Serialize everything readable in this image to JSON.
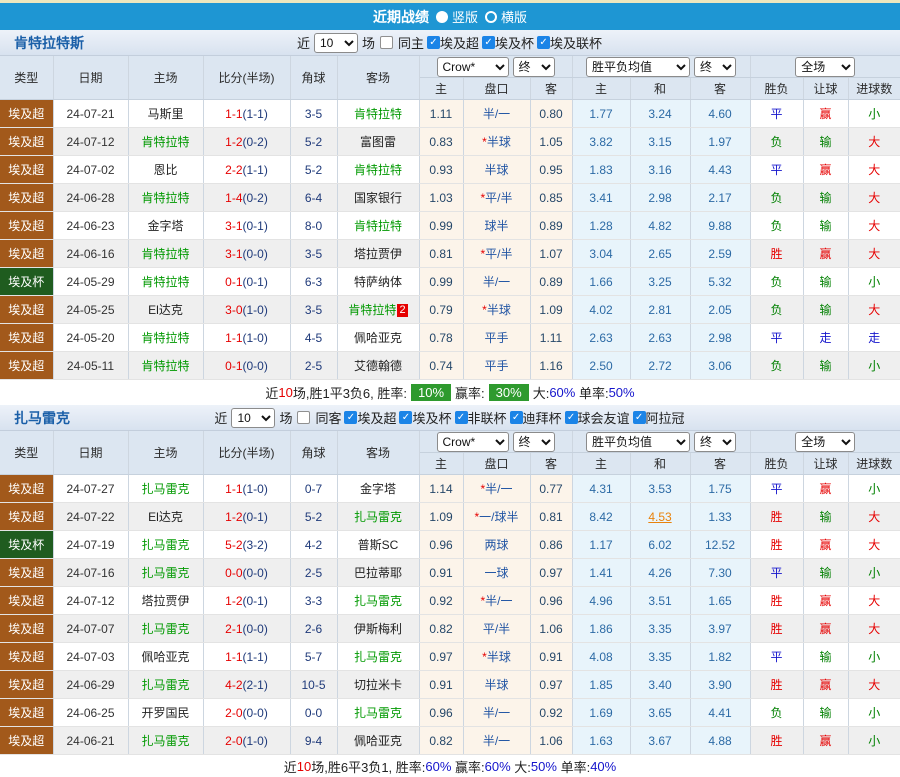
{
  "title_bar": {
    "title": "近期战绩",
    "vertical": "竖版",
    "horizontal": "横版"
  },
  "columns": {
    "type": "类型",
    "date": "日期",
    "home": "主场",
    "score": "比分(半场)",
    "corners": "角球",
    "away": "客场",
    "asia_home": "主",
    "asia_handicap": "盘口",
    "asia_away": "客",
    "euro_home": "主",
    "euro_draw": "和",
    "euro_away": "客",
    "res_wdl": "胜负",
    "res_handicap": "让球",
    "res_goals": "进球数"
  },
  "controls": {
    "bookmaker": "Crow*",
    "asia_state": "终",
    "europe_avg": "胜平负均值",
    "europe_state": "终",
    "scope": "全场"
  },
  "league_colors": {
    "埃及超": "#A2591B",
    "埃及杯": "#1F5C1F"
  },
  "colors": {
    "topbar": "#1E96D3",
    "self_green": "#009900",
    "win_red": "#E60000",
    "draw_blue": "#1414CC",
    "lose_green": "#008000",
    "badge_green": "#2E9A2E"
  },
  "sections": [
    {
      "team": "肯特拉特斯",
      "filter": {
        "near": "近",
        "count": "10",
        "games": "场",
        "same": "同主",
        "leagues": [
          "埃及超",
          "埃及杯",
          "埃及联杯"
        ]
      },
      "rows": [
        {
          "type": "埃及超",
          "date": "24-07-21",
          "home": "马斯里",
          "home_self": false,
          "ft": "1-1",
          "ht": "(1-1)",
          "corners": "3-5",
          "away": "肯特拉特",
          "away_self": true,
          "asia": [
            "1.11",
            "半/一",
            "0.80"
          ],
          "euro": [
            "1.77",
            "3.24",
            "4.60"
          ],
          "res": [
            [
              "平",
              "b"
            ],
            [
              "赢",
              "r"
            ],
            [
              "小",
              "g"
            ]
          ]
        },
        {
          "type": "埃及超",
          "date": "24-07-12",
          "home": "肯特拉特",
          "home_self": true,
          "ft": "1-2",
          "ht": "(0-2)",
          "corners": "5-2",
          "away": "富图雷",
          "away_self": false,
          "asia": [
            "0.83",
            "*半球",
            "1.05"
          ],
          "euro": [
            "3.82",
            "3.15",
            "1.97"
          ],
          "res": [
            [
              "负",
              "g"
            ],
            [
              "输",
              "g"
            ],
            [
              "大",
              "r"
            ]
          ]
        },
        {
          "type": "埃及超",
          "date": "24-07-02",
          "home": "恩比",
          "home_self": false,
          "ft": "2-2",
          "ht": "(1-1)",
          "corners": "5-2",
          "away": "肯特拉特",
          "away_self": true,
          "asia": [
            "0.93",
            "半球",
            "0.95"
          ],
          "euro": [
            "1.83",
            "3.16",
            "4.43"
          ],
          "res": [
            [
              "平",
              "b"
            ],
            [
              "赢",
              "r"
            ],
            [
              "大",
              "r"
            ]
          ]
        },
        {
          "type": "埃及超",
          "date": "24-06-28",
          "home": "肯特拉特",
          "home_self": true,
          "ft": "1-4",
          "ht": "(0-2)",
          "corners": "6-4",
          "away": "国家银行",
          "away_self": false,
          "asia": [
            "1.03",
            "*平/半",
            "0.85"
          ],
          "euro": [
            "3.41",
            "2.98",
            "2.17"
          ],
          "res": [
            [
              "负",
              "g"
            ],
            [
              "输",
              "g"
            ],
            [
              "大",
              "r"
            ]
          ]
        },
        {
          "type": "埃及超",
          "date": "24-06-23",
          "home": "金字塔",
          "home_self": false,
          "ft": "3-1",
          "ht": "(0-1)",
          "corners": "8-0",
          "away": "肯特拉特",
          "away_self": true,
          "asia": [
            "0.99",
            "球半",
            "0.89"
          ],
          "euro": [
            "1.28",
            "4.82",
            "9.88"
          ],
          "res": [
            [
              "负",
              "g"
            ],
            [
              "输",
              "g"
            ],
            [
              "大",
              "r"
            ]
          ]
        },
        {
          "type": "埃及超",
          "date": "24-06-16",
          "home": "肯特拉特",
          "home_self": true,
          "ft": "3-1",
          "ht": "(0-0)",
          "corners": "3-5",
          "away": "塔拉贾伊",
          "away_self": false,
          "asia": [
            "0.81",
            "*平/半",
            "1.07"
          ],
          "euro": [
            "3.04",
            "2.65",
            "2.59"
          ],
          "res": [
            [
              "胜",
              "r"
            ],
            [
              "赢",
              "r"
            ],
            [
              "大",
              "r"
            ]
          ]
        },
        {
          "type": "埃及杯",
          "date": "24-05-29",
          "home": "肯特拉特",
          "home_self": true,
          "ft": "0-1",
          "ht": "(0-1)",
          "corners": "6-3",
          "away": "特萨纳体",
          "away_self": false,
          "asia": [
            "0.99",
            "半/一",
            "0.89"
          ],
          "euro": [
            "1.66",
            "3.25",
            "5.32"
          ],
          "res": [
            [
              "负",
              "g"
            ],
            [
              "输",
              "g"
            ],
            [
              "小",
              "g"
            ]
          ]
        },
        {
          "type": "埃及超",
          "date": "24-05-25",
          "home": "El达克",
          "home_self": false,
          "ft": "3-0",
          "ht": "(1-0)",
          "corners": "3-5",
          "away": "肯特拉特",
          "away_self": true,
          "away_badge": "2",
          "asia": [
            "0.79",
            "*半球",
            "1.09"
          ],
          "euro": [
            "4.02",
            "2.81",
            "2.05"
          ],
          "res": [
            [
              "负",
              "g"
            ],
            [
              "输",
              "g"
            ],
            [
              "大",
              "r"
            ]
          ]
        },
        {
          "type": "埃及超",
          "date": "24-05-20",
          "home": "肯特拉特",
          "home_self": true,
          "ft": "1-1",
          "ht": "(1-0)",
          "corners": "4-5",
          "away": "佩哈亚克",
          "away_self": false,
          "asia": [
            "0.78",
            "平手",
            "1.11"
          ],
          "euro": [
            "2.63",
            "2.63",
            "2.98"
          ],
          "res": [
            [
              "平",
              "b"
            ],
            [
              "走",
              "b"
            ],
            [
              "走",
              "b"
            ]
          ]
        },
        {
          "type": "埃及超",
          "date": "24-05-11",
          "home": "肯特拉特",
          "home_self": true,
          "ft": "0-1",
          "ht": "(0-0)",
          "corners": "2-5",
          "away": "艾德翰德",
          "away_self": false,
          "asia": [
            "0.74",
            "平手",
            "1.16"
          ],
          "euro": [
            "2.50",
            "2.72",
            "3.06"
          ],
          "res": [
            [
              "负",
              "g"
            ],
            [
              "输",
              "g"
            ],
            [
              "小",
              "g"
            ]
          ]
        }
      ],
      "summary": [
        [
          "近",
          "k"
        ],
        [
          "10",
          "r"
        ],
        [
          "场,胜1平3负6, 胜率:",
          "k"
        ],
        [
          "10%",
          "badge"
        ],
        [
          "赢率:",
          "k"
        ],
        [
          "30%",
          "badge"
        ],
        [
          "大:",
          "k"
        ],
        [
          "60%",
          "b"
        ],
        [
          " 单率:",
          "k"
        ],
        [
          "50%",
          "b"
        ]
      ]
    },
    {
      "team": "扎马雷克",
      "filter": {
        "near": "近",
        "count": "10",
        "games": "场",
        "same": "同客",
        "leagues": [
          "埃及超",
          "埃及杯",
          "非联杯",
          "迪拜杯",
          "球会友谊",
          "阿拉冠"
        ]
      },
      "rows": [
        {
          "type": "埃及超",
          "date": "24-07-27",
          "home": "扎马雷克",
          "home_self": true,
          "ft": "1-1",
          "ht": "(1-0)",
          "corners": "0-7",
          "away": "金字塔",
          "away_self": false,
          "asia": [
            "1.14",
            "*半/一",
            "0.77"
          ],
          "euro": [
            "4.31",
            "3.53",
            "1.75"
          ],
          "res": [
            [
              "平",
              "b"
            ],
            [
              "赢",
              "r"
            ],
            [
              "小",
              "g"
            ]
          ]
        },
        {
          "type": "埃及超",
          "date": "24-07-22",
          "home": "El达克",
          "home_self": false,
          "ft": "1-2",
          "ht": "(0-1)",
          "corners": "5-2",
          "away": "扎马雷克",
          "away_self": true,
          "asia": [
            "1.09",
            "*一/球半",
            "0.81"
          ],
          "euro": [
            "8.42",
            "4.53",
            "1.33"
          ],
          "euro_hl": 1,
          "res": [
            [
              "胜",
              "r"
            ],
            [
              "输",
              "g"
            ],
            [
              "大",
              "r"
            ]
          ]
        },
        {
          "type": "埃及杯",
          "date": "24-07-19",
          "home": "扎马雷克",
          "home_self": true,
          "ft": "5-2",
          "ht": "(3-2)",
          "corners": "4-2",
          "away": "普斯SC",
          "away_self": false,
          "asia": [
            "0.96",
            "两球",
            "0.86"
          ],
          "euro": [
            "1.17",
            "6.02",
            "12.52"
          ],
          "res": [
            [
              "胜",
              "r"
            ],
            [
              "赢",
              "r"
            ],
            [
              "大",
              "r"
            ]
          ]
        },
        {
          "type": "埃及超",
          "date": "24-07-16",
          "home": "扎马雷克",
          "home_self": true,
          "ft": "0-0",
          "ht": "(0-0)",
          "corners": "2-5",
          "away": "巴拉蒂耶",
          "away_self": false,
          "asia": [
            "0.91",
            "一球",
            "0.97"
          ],
          "euro": [
            "1.41",
            "4.26",
            "7.30"
          ],
          "res": [
            [
              "平",
              "b"
            ],
            [
              "输",
              "g"
            ],
            [
              "小",
              "g"
            ]
          ]
        },
        {
          "type": "埃及超",
          "date": "24-07-12",
          "home": "塔拉贾伊",
          "home_self": false,
          "ft": "1-2",
          "ht": "(0-1)",
          "corners": "3-3",
          "away": "扎马雷克",
          "away_self": true,
          "asia": [
            "0.92",
            "*半/一",
            "0.96"
          ],
          "euro": [
            "4.96",
            "3.51",
            "1.65"
          ],
          "res": [
            [
              "胜",
              "r"
            ],
            [
              "赢",
              "r"
            ],
            [
              "大",
              "r"
            ]
          ]
        },
        {
          "type": "埃及超",
          "date": "24-07-07",
          "home": "扎马雷克",
          "home_self": true,
          "ft": "2-1",
          "ht": "(0-0)",
          "corners": "2-6",
          "away": "伊斯梅利",
          "away_self": false,
          "asia": [
            "0.82",
            "平/半",
            "1.06"
          ],
          "euro": [
            "1.86",
            "3.35",
            "3.97"
          ],
          "res": [
            [
              "胜",
              "r"
            ],
            [
              "赢",
              "r"
            ],
            [
              "大",
              "r"
            ]
          ]
        },
        {
          "type": "埃及超",
          "date": "24-07-03",
          "home": "佩哈亚克",
          "home_self": false,
          "ft": "1-1",
          "ht": "(1-1)",
          "corners": "5-7",
          "away": "扎马雷克",
          "away_self": true,
          "asia": [
            "0.97",
            "*半球",
            "0.91"
          ],
          "euro": [
            "4.08",
            "3.35",
            "1.82"
          ],
          "res": [
            [
              "平",
              "b"
            ],
            [
              "输",
              "g"
            ],
            [
              "小",
              "g"
            ]
          ]
        },
        {
          "type": "埃及超",
          "date": "24-06-29",
          "home": "扎马雷克",
          "home_self": true,
          "ft": "4-2",
          "ht": "(2-1)",
          "corners": "10-5",
          "away": "切拉米卡",
          "away_self": false,
          "asia": [
            "0.91",
            "半球",
            "0.97"
          ],
          "euro": [
            "1.85",
            "3.40",
            "3.90"
          ],
          "res": [
            [
              "胜",
              "r"
            ],
            [
              "赢",
              "r"
            ],
            [
              "大",
              "r"
            ]
          ]
        },
        {
          "type": "埃及超",
          "date": "24-06-25",
          "home": "开罗国民",
          "home_self": false,
          "ft": "2-0",
          "ht": "(0-0)",
          "corners": "0-0",
          "away": "扎马雷克",
          "away_self": true,
          "asia": [
            "0.96",
            "半/一",
            "0.92"
          ],
          "euro": [
            "1.69",
            "3.65",
            "4.41"
          ],
          "res": [
            [
              "负",
              "g"
            ],
            [
              "输",
              "g"
            ],
            [
              "小",
              "g"
            ]
          ]
        },
        {
          "type": "埃及超",
          "date": "24-06-21",
          "home": "扎马雷克",
          "home_self": true,
          "ft": "2-0",
          "ht": "(1-0)",
          "corners": "9-4",
          "away": "佩哈亚克",
          "away_self": false,
          "asia": [
            "0.82",
            "半/一",
            "1.06"
          ],
          "euro": [
            "1.63",
            "3.67",
            "4.88"
          ],
          "res": [
            [
              "胜",
              "r"
            ],
            [
              "赢",
              "r"
            ],
            [
              "小",
              "g"
            ]
          ]
        }
      ],
      "summary": [
        [
          "近",
          "k"
        ],
        [
          "10",
          "r"
        ],
        [
          "场,胜6平3负1, 胜率:",
          "k"
        ],
        [
          "60%",
          "b"
        ],
        [
          " 赢率:",
          "k"
        ],
        [
          "60%",
          "b"
        ],
        [
          " 大:",
          "k"
        ],
        [
          "50%",
          "b"
        ],
        [
          " 单率:",
          "k"
        ],
        [
          "40%",
          "b"
        ]
      ]
    }
  ]
}
